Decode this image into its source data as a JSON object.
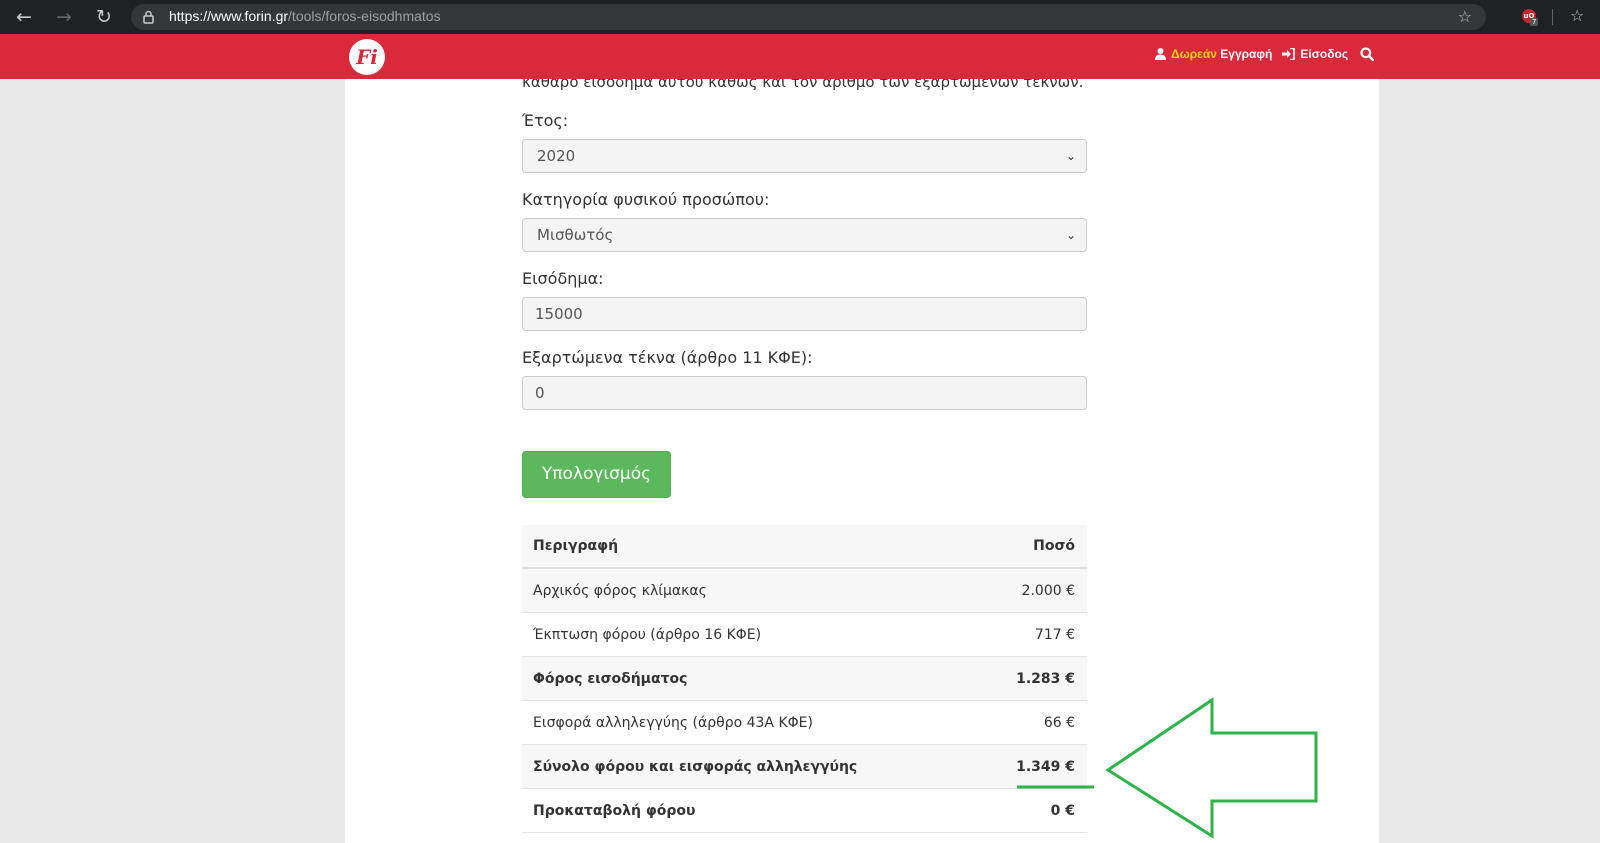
{
  "browser": {
    "url_host": "https://www.forin.gr",
    "url_path": "/tools/foros-eisodhmatos",
    "extension_badge": "7"
  },
  "header": {
    "logo_text": "Fi",
    "free_label": "Δωρεάν",
    "register_label": "Εγγραφή",
    "login_label": "Είσοδος"
  },
  "form": {
    "intro_text": "καθαρό εισόδημα αυτού καθώς και τον αριθμό των εξαρτώμενων τέκνων.",
    "year_label": "Έτος:",
    "year_value": "2020",
    "category_label": "Κατηγορία φυσικού προσώπου:",
    "category_value": "Μισθωτός",
    "income_label": "Εισόδημα:",
    "income_value": "15000",
    "children_label": "Εξαρτώμενα τέκνα (άρθρο 11 ΚΦΕ):",
    "children_value": "0",
    "calculate_label": "Υπολογισμός"
  },
  "results": {
    "header_description": "Περιγραφή",
    "header_amount": "Ποσό",
    "rows": [
      {
        "description": "Αρχικός φόρος κλίμακας",
        "amount": "2.000 €"
      },
      {
        "description": "Έκπτωση φόρου (άρθρο 16 ΚΦΕ)",
        "amount": "717 €"
      },
      {
        "description": "Φόρος εισοδήματος",
        "amount": "1.283 €"
      },
      {
        "description": "Εισφορά αλληλεγγύης (άρθρο 43Α ΚΦΕ)",
        "amount": "66 €"
      },
      {
        "description": "Σύνολο φόρου και εισφοράς αλληλεγγύης",
        "amount": "1.349 €"
      },
      {
        "description": "Προκαταβολή φόρου",
        "amount": "0 €"
      }
    ]
  },
  "colors": {
    "brand_red": "#d9293b",
    "button_green": "#5cb85c",
    "annotation_green": "#2db34a",
    "free_yellow": "#ffd400"
  },
  "icons": [
    "back-icon",
    "forward-icon",
    "reload-icon",
    "lock-icon",
    "star-icon",
    "user-icon",
    "login-icon",
    "search-icon"
  ]
}
